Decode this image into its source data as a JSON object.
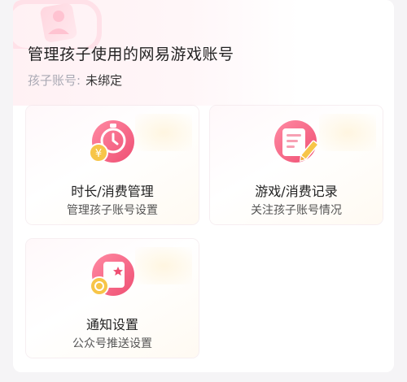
{
  "header": {
    "title": "管理孩子使用的网易游戏账号",
    "account_label": "孩子账号:",
    "account_value": "未绑定"
  },
  "cards": [
    {
      "title": "时长/消费管理",
      "subtitle": "管理孩子账号设置",
      "icon": "stopwatch-coin-icon"
    },
    {
      "title": "游戏/消费记录",
      "subtitle": "关注孩子账号情况",
      "icon": "records-pencil-icon"
    },
    {
      "title": "通知设置",
      "subtitle": "公众号推送设置",
      "icon": "notification-star-icon"
    }
  ],
  "colors": {
    "accent_pink": "#f0577b",
    "coin_gold": "#f7c548",
    "card_bg": "#fff8fa"
  }
}
